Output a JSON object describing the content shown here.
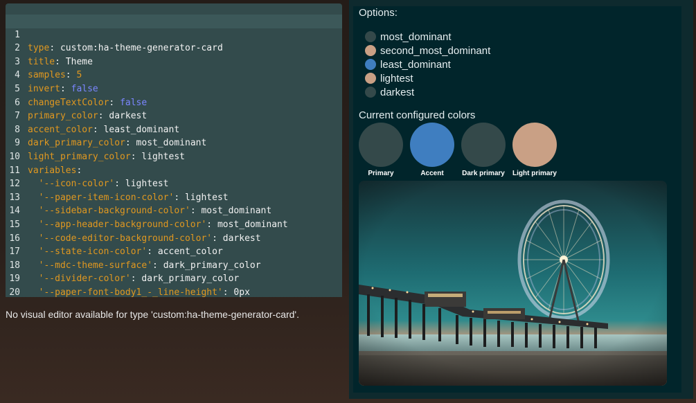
{
  "editor": {
    "lines": [
      {
        "n": "1",
        "key": "type",
        "value": "custom:ha-theme-generator-card"
      },
      {
        "n": "2",
        "key": "title",
        "value": "Theme"
      },
      {
        "n": "3",
        "key": "samples",
        "value": "5"
      },
      {
        "n": "4",
        "key": "invert",
        "value": "false"
      },
      {
        "n": "5",
        "key": "changeTextColor",
        "value": "false"
      },
      {
        "n": "6",
        "key": "primary_color",
        "value": "darkest"
      },
      {
        "n": "7",
        "key": "accent_color",
        "value": "least_dominant"
      },
      {
        "n": "8",
        "key": "dark_primary_color",
        "value": "most_dominant"
      },
      {
        "n": "9",
        "key": "light_primary_color",
        "value": "lightest"
      },
      {
        "n": "10",
        "key": "variables",
        "value": ""
      },
      {
        "n": "11",
        "key": "'--icon-color'",
        "value": "lightest"
      },
      {
        "n": "12",
        "key": "'--paper-item-icon-color'",
        "value": "lightest"
      },
      {
        "n": "13",
        "key": "'--sidebar-background-color'",
        "value": "most_dominant"
      },
      {
        "n": "14",
        "key": "'--app-header-background-color'",
        "value": "most_dominant"
      },
      {
        "n": "15",
        "key": "'--code-editor-background-color'",
        "value": "darkest"
      },
      {
        "n": "16",
        "key": "'--state-icon-color'",
        "value": "accent_color"
      },
      {
        "n": "17",
        "key": "'--mdc-theme-surface'",
        "value": "dark_primary_color"
      },
      {
        "n": "18",
        "key": "'--divider-color'",
        "value": "dark_primary_color"
      },
      {
        "n": "19",
        "key": "'--paper-font-body1_-_line-height'",
        "value": "0px"
      },
      {
        "n": "20",
        "key": "",
        "value": ""
      }
    ],
    "no_visual_editor": "No visual editor available for type 'custom:ha-theme-generator-card'."
  },
  "card": {
    "options_title": "Options:",
    "options": [
      {
        "label": "most_dominant",
        "color": "#34494a"
      },
      {
        "label": "second_most_dominant",
        "color": "#c9a085"
      },
      {
        "label": "least_dominant",
        "color": "#3f7ec0"
      },
      {
        "label": "lightest",
        "color": "#c9a085"
      },
      {
        "label": "darkest",
        "color": "#34494a"
      }
    ],
    "colors_title": "Current configured colors",
    "swatches": [
      {
        "label": "Primary",
        "color": "#34494a"
      },
      {
        "label": "Accent",
        "color": "#3f7ec0"
      },
      {
        "label": "Dark primary",
        "color": "#34494a"
      },
      {
        "label": "Light primary",
        "color": "#c9a085"
      }
    ]
  }
}
